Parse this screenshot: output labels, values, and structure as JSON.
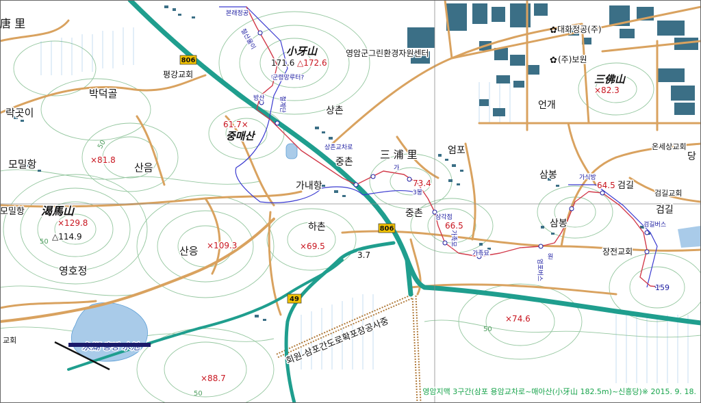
{
  "colors": {
    "paper": "#ffffff",
    "contour": "#8fc49a",
    "road_local": "#d9a25f",
    "road_highway": "#1f9e8e",
    "building": "#3b6f86",
    "hiking_route": "#d23a4a",
    "blue_track": "#3a3ad0",
    "water": "#a9cbe9",
    "grid": "#888888",
    "elevation_text": "#c8141e",
    "caption_text": "#16a34a"
  },
  "places": {
    "tang_ri": "唐 里",
    "bakdeokgol": "박덕골",
    "rakgongi": "락곳이",
    "momilhang": "모밀항",
    "saneum": "산음",
    "gal_ma_san": "渴馬山",
    "momilhang2": "모밀항",
    "saneung": "산응",
    "yeonghojeong": "영호정",
    "gyohoe_left": "교회",
    "pyeonggang_church": "평강교회",
    "so_a_san": "小牙山",
    "jungmaesan": "중매산",
    "sangchon": "상촌",
    "jungchon": "중촌",
    "sampo_ri": "三 浦 里",
    "ganaehang": "가내항",
    "hachon": "하촌",
    "jungchon2": "중촌",
    "eompo": "엄포",
    "sambong": "삼봉",
    "sambong2": "삼봉",
    "eongae": "언개",
    "sambulsan": "三佛山",
    "gimgil": "검길",
    "gimgil2": "검길",
    "jangjeon_church": "장전교회",
    "onse_church": "온세상교회",
    "daehwa": "대화정공(주)",
    "bowon": "(주)보원",
    "greencenter": "영암군그린환경자원센터",
    "reservoir": "永湖 흥방 水池",
    "construction": "회원-삼포간도로확포장공사중",
    "dang": "당",
    "gimgil_church": "검길교회"
  },
  "elevations": {
    "e1716": "171.6",
    "e1726": "△172.6",
    "e617": "61.7×",
    "e818": "×81.8",
    "e1298": "×129.8",
    "e1149": "△114.9",
    "e1093": "×109.3",
    "e695": "×69.5",
    "e37": "3.7",
    "e734": "73.4",
    "e665": "66.5",
    "e645": "64.5",
    "e823": "×82.3",
    "e746": "×74.6",
    "e887": "×88.7",
    "e159": "159",
    "contour50a": "50",
    "contour50b": "50",
    "contour50c": "50",
    "contour50d": "50"
  },
  "route_labels": {
    "bonneaejeong": "본래정공",
    "cheolsan": "철산울이",
    "gunryeong": "군령망루터?",
    "bangsan": "방산",
    "cheolgye": "철계단",
    "sangchon_junction": "상촌교차로",
    "jeupok": "3봉",
    "hwaijang": "삼각점",
    "gajeok": "가족묘",
    "gajangmyo": "가족묘",
    "eompo_bus": "엄포버스",
    "gasikbang": "가식방",
    "gimgil_bus": "검길버스",
    "won": "원",
    "ga": "가"
  },
  "road_shields": {
    "r806a": "806",
    "r806b": "806",
    "r49": "49"
  },
  "caption": "영암지맥 3구간(삼포 용암교차로~매아산(小牙山 182.5m)~신흥당)※  2015. 9. 18."
}
